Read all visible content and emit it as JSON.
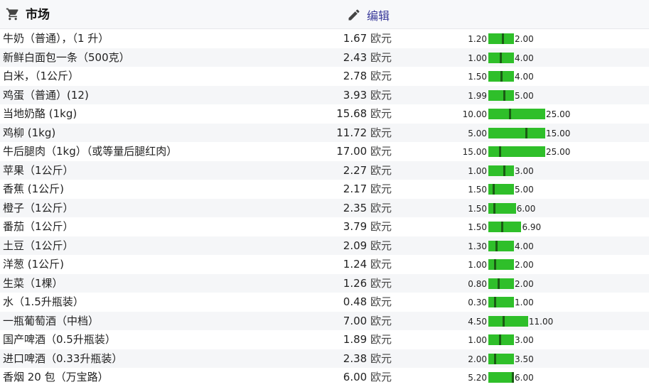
{
  "header": {
    "title": "市场",
    "edit_label": "编辑",
    "cart_icon": "shopping-cart-icon",
    "edit_icon": "pencil-icon"
  },
  "colors": {
    "bar": "#2fbf2a",
    "marker": "#1a5c14",
    "link": "#3a3a9a"
  },
  "items": [
    {
      "name": "牛奶（普通），（1 升）",
      "price": "1.67",
      "currency": "欧元",
      "min": "1.20",
      "max": "2.00",
      "value": 1.67
    },
    {
      "name": "新鲜白面包一条（500克）",
      "price": "2.43",
      "currency": "欧元",
      "min": "1.00",
      "max": "4.00",
      "value": 2.43
    },
    {
      "name": "白米，（1公斤）",
      "price": "2.78",
      "currency": "欧元",
      "min": "1.50",
      "max": "4.00",
      "value": 2.78
    },
    {
      "name": "鸡蛋（普通）(12)",
      "price": "3.93",
      "currency": "欧元",
      "min": "1.99",
      "max": "5.00",
      "value": 3.93
    },
    {
      "name": "当地奶酪 (1kg)",
      "price": "15.68",
      "currency": "欧元",
      "min": "10.00",
      "max": "25.00",
      "value": 15.68
    },
    {
      "name": "鸡柳 (1kg)",
      "price": "11.72",
      "currency": "欧元",
      "min": "5.00",
      "max": "15.00",
      "value": 11.72
    },
    {
      "name": "牛后腿肉（1kg）（或等量后腿红肉）",
      "price": "17.00",
      "currency": "欧元",
      "min": "15.00",
      "max": "25.00",
      "value": 17.0
    },
    {
      "name": "苹果（1公斤）",
      "price": "2.27",
      "currency": "欧元",
      "min": "1.00",
      "max": "3.00",
      "value": 2.27
    },
    {
      "name": "香蕉 (1公斤)",
      "price": "2.17",
      "currency": "欧元",
      "min": "1.50",
      "max": "5.00",
      "value": 2.17
    },
    {
      "name": "橙子（1公斤）",
      "price": "2.35",
      "currency": "欧元",
      "min": "1.50",
      "max": "6.00",
      "value": 2.35
    },
    {
      "name": "番茄（1公斤）",
      "price": "3.79",
      "currency": "欧元",
      "min": "1.50",
      "max": "6.90",
      "value": 3.79
    },
    {
      "name": "土豆（1公斤）",
      "price": "2.09",
      "currency": "欧元",
      "min": "1.30",
      "max": "4.00",
      "value": 2.09
    },
    {
      "name": "洋葱 (1公斤)",
      "price": "1.24",
      "currency": "欧元",
      "min": "1.00",
      "max": "2.00",
      "value": 1.24
    },
    {
      "name": "生菜（1棵）",
      "price": "1.26",
      "currency": "欧元",
      "min": "0.80",
      "max": "2.00",
      "value": 1.26
    },
    {
      "name": "水（1.5升瓶装）",
      "price": "0.48",
      "currency": "欧元",
      "min": "0.30",
      "max": "1.00",
      "value": 0.48
    },
    {
      "name": "一瓶葡萄酒（中档）",
      "price": "7.00",
      "currency": "欧元",
      "min": "4.50",
      "max": "11.00",
      "value": 7.0
    },
    {
      "name": "国产啤酒（0.5升瓶装）",
      "price": "1.89",
      "currency": "欧元",
      "min": "1.00",
      "max": "3.00",
      "value": 1.89
    },
    {
      "name": "进口啤酒（0.33升瓶装）",
      "price": "2.38",
      "currency": "欧元",
      "min": "2.00",
      "max": "3.50",
      "value": 2.38
    },
    {
      "name": "香烟 20 包（万宝路）",
      "price": "6.00",
      "currency": "欧元",
      "min": "5.20",
      "max": "6.00",
      "value": 6.0
    }
  ]
}
